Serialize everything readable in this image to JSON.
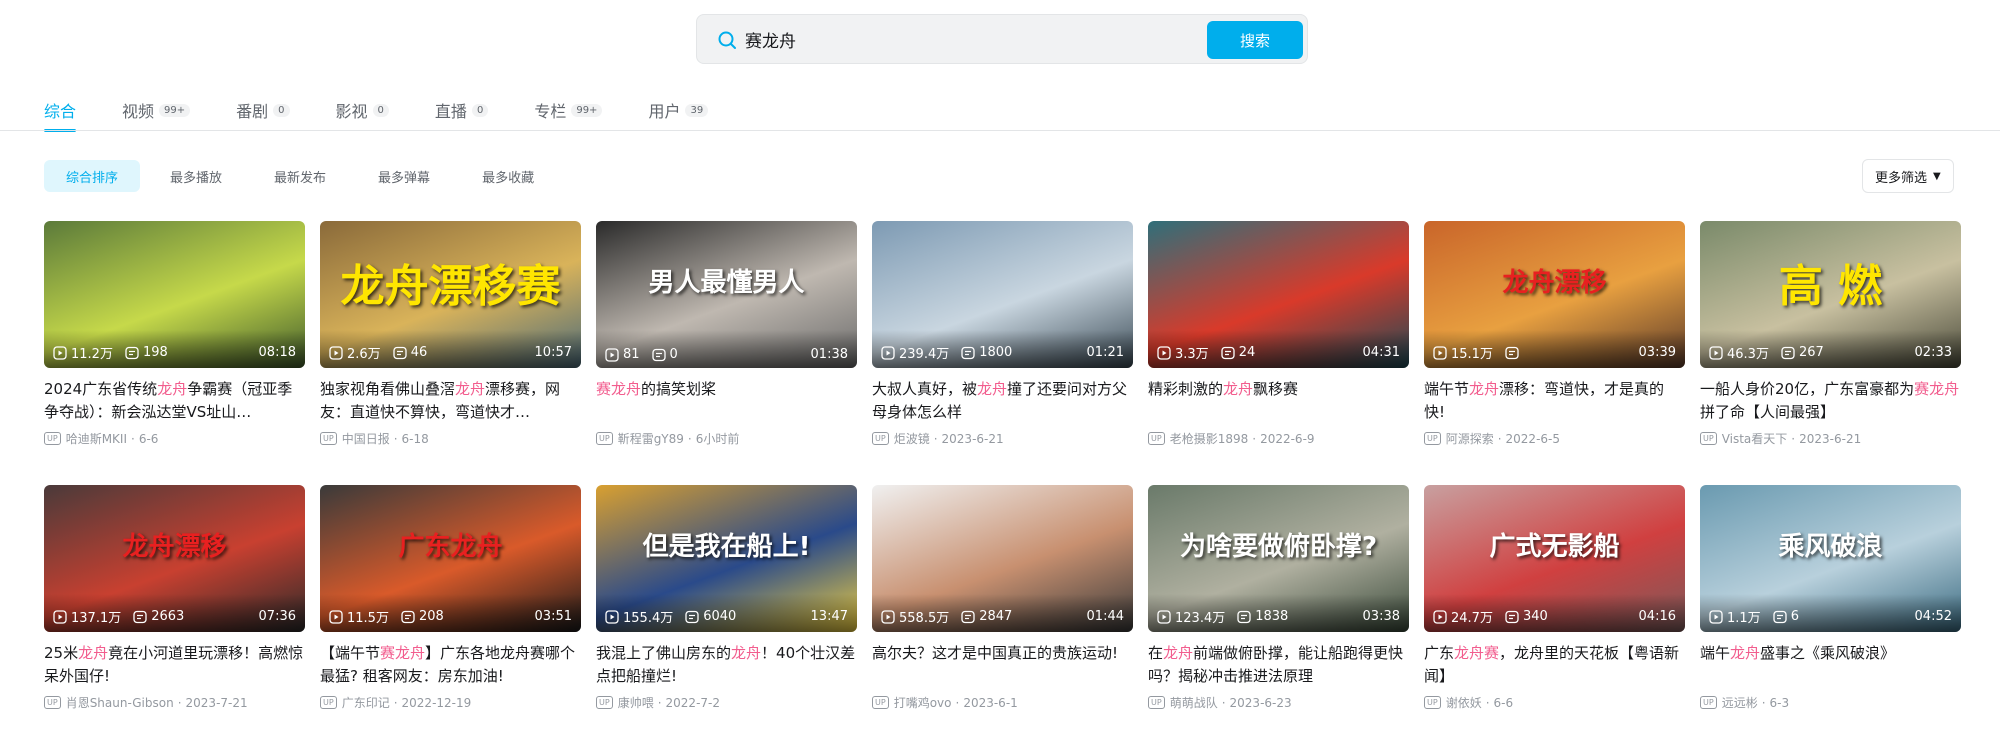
{
  "search": {
    "query": "赛龙舟",
    "button": "搜索"
  },
  "tabs": [
    {
      "label": "综合",
      "count": ""
    },
    {
      "label": "视频",
      "count": "99+"
    },
    {
      "label": "番剧",
      "count": "0"
    },
    {
      "label": "影视",
      "count": "0"
    },
    {
      "label": "直播",
      "count": "0"
    },
    {
      "label": "专栏",
      "count": "99+"
    },
    {
      "label": "用户",
      "count": "39"
    }
  ],
  "sorts": [
    "综合排序",
    "最多播放",
    "最新发布",
    "最多弹幕",
    "最多收藏"
  ],
  "more_filter": "更多筛选",
  "up_badge": "UP",
  "videos": [
    {
      "title": [
        "2024广东省传统",
        "龙舟",
        "争霸赛（冠亚季争夺战）：新会泓达堂VS址山…"
      ],
      "views": "11.2万",
      "danmaku": "198",
      "duration": "08:18",
      "author": "哈迪斯MKII",
      "date": "6-6",
      "caption": "",
      "colors": [
        "#5b7a3a",
        "#c6d94a",
        "#3f5a2c"
      ]
    },
    {
      "title": [
        "独家视角看佛山叠滘",
        "龙舟",
        "漂移赛，网友：直道快不算快，弯道快才…"
      ],
      "views": "2.6万",
      "danmaku": "46",
      "duration": "10:57",
      "author": "中国日报",
      "date": "6-18",
      "caption": "龙舟漂移赛",
      "colors": [
        "#8a6a3a",
        "#d9b35a",
        "#4a6a7a"
      ]
    },
    {
      "title": [
        "",
        "赛龙舟",
        "的搞笑划桨"
      ],
      "views": "81",
      "danmaku": "0",
      "duration": "01:38",
      "author": "靳程雷gY89",
      "date": "6小时前",
      "caption": "男人最懂男人",
      "colors": [
        "#2a2a2a",
        "#bfb8b0",
        "#6a6a6a"
      ]
    },
    {
      "title": [
        "大叔人真好，被",
        "龙舟",
        "撞了还要问对方父母身体怎么样"
      ],
      "views": "239.4万",
      "danmaku": "1800",
      "duration": "01:21",
      "author": "炬波镜",
      "date": "2023-6-21",
      "caption": "",
      "colors": [
        "#7d9ab3",
        "#c9d6e0",
        "#3a4a55"
      ]
    },
    {
      "title": [
        "精彩刺激的",
        "龙舟",
        "飘移赛"
      ],
      "views": "3.3万",
      "danmaku": "24",
      "duration": "04:31",
      "author": "老枪摄影1898",
      "date": "2022-6-9",
      "caption": "",
      "colors": [
        "#2f6f7a",
        "#d93a2a",
        "#1d4a55"
      ]
    },
    {
      "title": [
        "端午节",
        "龙舟",
        "漂移：弯道快，才是真的快!"
      ],
      "views": "15.1万",
      "danmaku": "",
      "duration": "03:39",
      "author": "阿源探索",
      "date": "2022-6-5",
      "caption": "龙舟漂移",
      "colors": [
        "#c9652a",
        "#e8a040",
        "#5a3a2a"
      ]
    },
    {
      "title": [
        "一船人身价20亿，广东富豪都为",
        "赛龙舟",
        "拼了命【人间最强】"
      ],
      "views": "46.3万",
      "danmaku": "267",
      "duration": "02:33",
      "author": "Vista看天下",
      "date": "2023-6-21",
      "caption": "高    燃",
      "colors": [
        "#7a8a6a",
        "#c8c0a0",
        "#4a4a3a"
      ]
    },
    {
      "title": [
        "25米",
        "龙舟",
        "竟在小河道里玩漂移！高燃惊呆外国仔!"
      ],
      "views": "137.1万",
      "danmaku": "2663",
      "duration": "07:36",
      "author": "肖恩Shaun-Gibson",
      "date": "2023-7-21",
      "caption": "龙舟漂移",
      "colors": [
        "#4a3a3a",
        "#c84030",
        "#2a2a2a"
      ]
    },
    {
      "title": [
        "【端午节",
        "赛龙舟",
        "】广东各地龙舟赛哪个最猛? 租客网友：房东加油!"
      ],
      "views": "11.5万",
      "danmaku": "208",
      "duration": "03:51",
      "author": "广东印记",
      "date": "2022-12-19",
      "caption": "广东龙舟",
      "colors": [
        "#3a3a3a",
        "#d95a2a",
        "#1a1a1a"
      ]
    },
    {
      "title": [
        "我混上了佛山房东的",
        "龙舟",
        "！40个壮汉差点把船撞烂!"
      ],
      "views": "155.4万",
      "danmaku": "6040",
      "duration": "13:47",
      "author": "康帅喂",
      "date": "2022-7-2",
      "caption": "但是我在船上!",
      "colors": [
        "#d9a030",
        "#2a4a8a",
        "#f0d040"
      ]
    },
    {
      "title": [
        "高尔夫？这才是中国真正的贵族运动!"
      ],
      "views": "558.5万",
      "danmaku": "2847",
      "duration": "01:44",
      "author": "打嘴鸡ovo",
      "date": "2023-6-1",
      "caption": "",
      "colors": [
        "#f0f0f0",
        "#c89070",
        "#3a3a3a"
      ]
    },
    {
      "title": [
        "在",
        "龙舟",
        "前端做俯卧撑，能让船跑得更快吗？揭秘冲击推进法原理"
      ],
      "views": "123.4万",
      "danmaku": "1838",
      "duration": "03:38",
      "author": "萌萌战队",
      "date": "2023-6-23",
      "caption": "为啥要做俯卧撑?",
      "colors": [
        "#6a7a6a",
        "#b0b0a0",
        "#3a4a3a"
      ]
    },
    {
      "title": [
        "广东",
        "龙舟赛",
        "，龙舟里的天花板【粤语新闻】"
      ],
      "views": "24.7万",
      "danmaku": "340",
      "duration": "04:16",
      "author": "谢依妖",
      "date": "6-6",
      "caption": "广式无影船",
      "colors": [
        "#c8a0a0",
        "#d04040",
        "#7a5a5a"
      ]
    },
    {
      "title": [
        "端午",
        "龙舟",
        "盛事之《乘风破浪》"
      ],
      "views": "1.1万",
      "danmaku": "6",
      "duration": "04:52",
      "author": "远远彬",
      "date": "6-3",
      "caption": "乘风破浪",
      "colors": [
        "#6a9ab0",
        "#b8d0dc",
        "#3a6a80"
      ]
    }
  ]
}
